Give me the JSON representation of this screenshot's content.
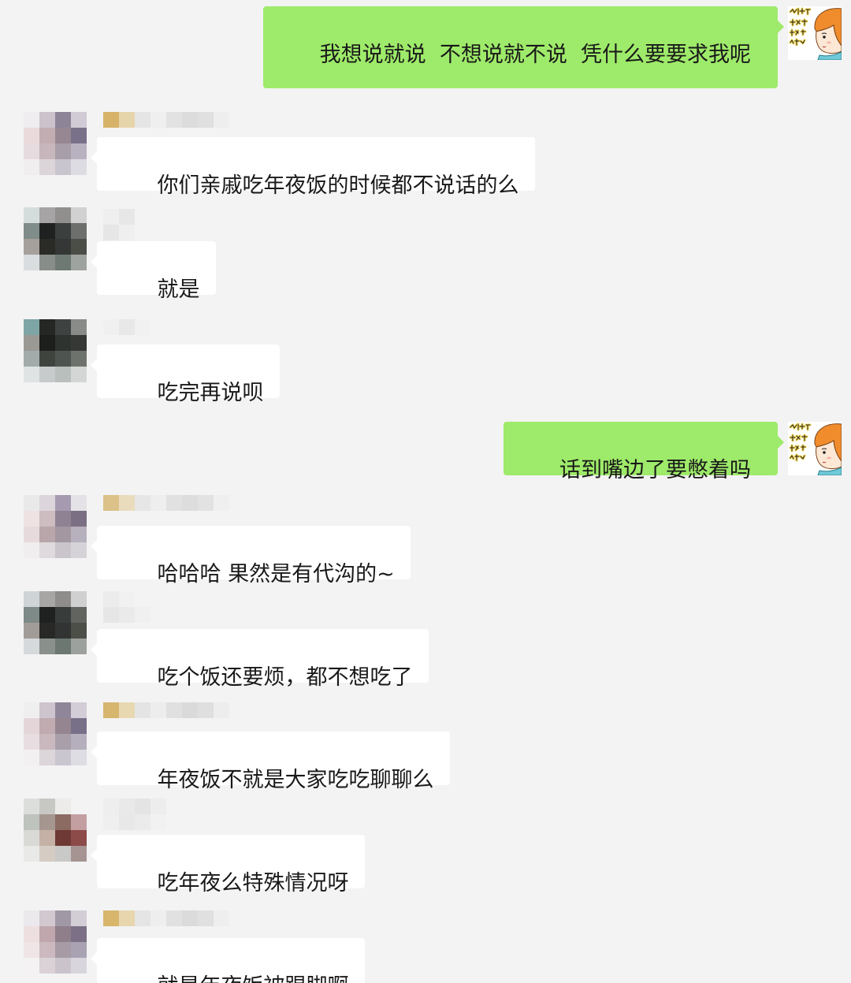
{
  "colors": {
    "background": "#f3f3f3",
    "self_bubble": "#9eea6a",
    "other_bubble": "#ffffff",
    "text": "#191919"
  },
  "chat": {
    "messages": [
      {
        "text": "我想说就说  不想说就不说  凭什么要要求我呢",
        "avatar_icon": "cartoon-girl-avatar"
      },
      {
        "text": "你们亲戚吃年夜饭的时候都不说话的么",
        "avatar_colors": [
          [
            "#efedef",
            "#cbc2cc",
            "#8e8498",
            "#d0cbd4"
          ],
          [
            "#eadadc",
            "#c2adb3",
            "#978792",
            "#797089"
          ],
          [
            "#e6dbdf",
            "#c7b6bb",
            "#a79ea9",
            "#b8b1bf"
          ],
          [
            "#f1eef0",
            "#dbd4d9",
            "#c8c5ce",
            "#dcdce2"
          ]
        ],
        "name_colors": [
          [
            "#d7b36a",
            "#e6d4ab",
            "#e5e5e5",
            "#efefef",
            "#e2e2e2",
            "#dcdcdc",
            "#e0e0e0",
            "#eeeeee"
          ]
        ]
      },
      {
        "text": "就是",
        "avatar_colors": [
          [
            "#d5dcdc",
            "#a6a4a4",
            "#908f8e",
            "#d0d1d0"
          ],
          [
            "#7f8c8a",
            "#1e211f",
            "#3b403e",
            "#6c6f6c"
          ],
          [
            "#a5a09c",
            "#2a2a27",
            "#343735",
            "#4b4d47"
          ],
          [
            "#dadddf",
            "#878d88",
            "#6f7973",
            "#9fa3a0"
          ]
        ],
        "name_colors": [
          [
            "#efefef",
            "#e7e7e7"
          ],
          [
            "#e6e6e6",
            "#efefef"
          ]
        ]
      },
      {
        "text": "吃完再说呗",
        "avatar_colors": [
          [
            "#7ea5a6",
            "#252724",
            "#3e4240",
            "#898b88"
          ],
          [
            "#9a9994",
            "#1d1f1d",
            "#2f3330",
            "#353834"
          ],
          [
            "#a2aaaa",
            "#3f443f",
            "#4e5551",
            "#6e726c"
          ],
          [
            "#dfe3e4",
            "#c7cbcb",
            "#b9bfbd",
            "#d4d6d5"
          ]
        ],
        "name_colors": [
          [
            "#f0f0f0",
            "#e8e8e8",
            "#f1f1f1"
          ]
        ]
      },
      {
        "text": "话到嘴边了要憋着吗",
        "avatar_icon": "cartoon-girl-avatar"
      },
      {
        "text": "哈哈哈 果然是有代沟的~",
        "avatar_colors": [
          [
            "#e9e9ea",
            "#dcd5dc",
            "#a59ab0",
            "#e4e2e6"
          ],
          [
            "#efe2e2",
            "#cdbcc0",
            "#8f8393",
            "#7a6f83"
          ],
          [
            "#e7dadc",
            "#b9a6ab",
            "#a397a1",
            "#b7b0bd"
          ],
          [
            "#f0eeee",
            "#dedadd",
            "#c9c5cb",
            "#d5d3d8"
          ]
        ],
        "name_colors": [
          [
            "#dcc189",
            "#e9dcbd",
            "#e6e6e6",
            "#eeeeee",
            "#e1e1e1",
            "#dddddd",
            "#e2e2e2",
            "#efefef"
          ]
        ]
      },
      {
        "text": "吃个饭还要烦，都不想吃了",
        "avatar_colors": [
          [
            "#cfd5d6",
            "#a8a6a5",
            "#8e8d8b",
            "#cfd0cf"
          ],
          [
            "#7d8a88",
            "#1e211f",
            "#383d3b",
            "#62645f"
          ],
          [
            "#a29c98",
            "#282926",
            "#313432",
            "#4c4e48"
          ],
          [
            "#d6d9db",
            "#8a908b",
            "#6d7772",
            "#9da19e"
          ]
        ],
        "name_colors": [
          [
            "#ececec",
            "#f1f1f1"
          ],
          [
            "#e6e6e6",
            "#eaeaea",
            "#f0f0f0"
          ]
        ]
      },
      {
        "text": "年夜饭不就是大家吃吃聊聊么",
        "avatar_colors": [
          [
            "#f0eff0",
            "#cdc4ce",
            "#908699",
            "#d2cdd6"
          ],
          [
            "#e4d6d8",
            "#c0abb1",
            "#958590",
            "#787089"
          ],
          [
            "#e8dde1",
            "#c9b8bd",
            "#a89fab",
            "#b5aebd"
          ],
          [
            "#f2f0f1",
            "#dcd5da",
            "#c9c6cf",
            "#dddde3"
          ]
        ],
        "name_colors": [
          [
            "#d6b56f",
            "#e8d8b2",
            "#e4e4e4",
            "#ededed",
            "#e0e0e0",
            "#dadada",
            "#dfdfdf",
            "#ededed"
          ]
        ]
      },
      {
        "text": "吃年夜么特殊情况呀",
        "avatar_colors": [
          [
            "#dcdedc",
            "#c7c8c3",
            "#ecebea",
            "#f3f3f3"
          ],
          [
            "#bfc3be",
            "#a5968f",
            "#8c6b63",
            "#c39fa2"
          ],
          [
            "#d9d9d6",
            "#c5b1a6",
            "#6e3934",
            "#8c4b49"
          ],
          [
            "#e9e9e7",
            "#d5ccc4",
            "#c9c9c7",
            "#a69493"
          ]
        ],
        "name_colors": [
          [
            "#eeeeee",
            "#e9e9e9",
            "#e4e4e4",
            "#ededed"
          ],
          [
            "#efefef",
            "#e8e8e8",
            "#ebebeb",
            "#f1f1f1"
          ]
        ]
      },
      {
        "text": "就是年夜饭被踢脚啊",
        "avatar_colors": [
          [
            "#ebe9ec",
            "#d1c8d0",
            "#a098a5",
            "#d3cdd6"
          ],
          [
            "#eddfe0",
            "#c0a7ad",
            "#8f7f8a",
            "#7b7086"
          ],
          [
            "#efe5e7",
            "#cbb9bf",
            "#a79ba5",
            "#a8a2b2"
          ],
          [
            "#f4f2f3",
            "#dad2d7",
            "#cac3cc",
            "#d8d6dc"
          ]
        ],
        "name_colors": [
          [
            "#d8b66c",
            "#e7d6ae",
            "#e5e5e5",
            "#eeeeee",
            "#e1e1e1",
            "#dbdbdb",
            "#e0e0e0",
            "#eeeeee"
          ]
        ]
      }
    ]
  }
}
